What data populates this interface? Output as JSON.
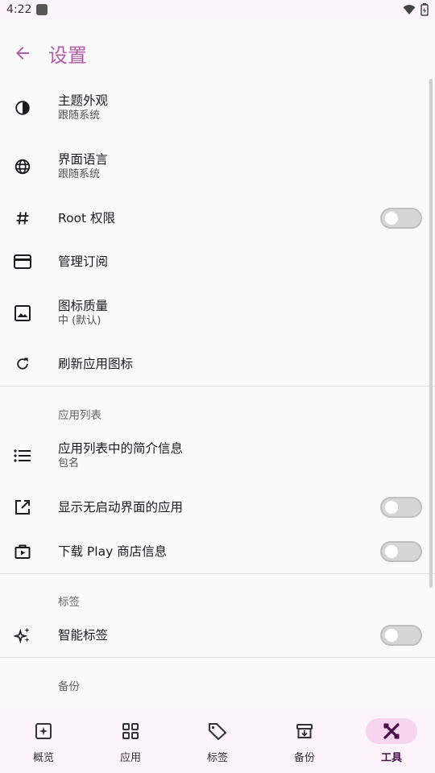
{
  "status_bar": {
    "time": "4:22"
  },
  "header": {
    "title": "设置"
  },
  "settings": [
    {
      "title": "主题外观",
      "subtitle": "跟随系统"
    },
    {
      "title": "界面语言",
      "subtitle": "跟随系统"
    },
    {
      "title": "Root 权限",
      "toggle": false
    },
    {
      "title": "管理订阅"
    },
    {
      "title": "图标质量",
      "subtitle": "中 (默认)"
    },
    {
      "title": "刷新应用图标"
    }
  ],
  "sections": {
    "app_list": {
      "header": "应用列表",
      "items": [
        {
          "title": "应用列表中的简介信息",
          "subtitle": "包名"
        },
        {
          "title": "显示无启动界面的应用",
          "toggle": false
        },
        {
          "title": "下载 Play 商店信息",
          "toggle": false
        }
      ]
    },
    "tags": {
      "header": "标签",
      "items": [
        {
          "title": "智能标签",
          "toggle": false
        }
      ]
    },
    "backup": {
      "header": "备份"
    }
  },
  "bottom_nav": [
    {
      "label": "概览",
      "icon": "overview-icon"
    },
    {
      "label": "应用",
      "icon": "apps-grid-icon"
    },
    {
      "label": "标签",
      "icon": "tag-icon"
    },
    {
      "label": "备份",
      "icon": "archive-icon"
    },
    {
      "label": "工具",
      "icon": "tools-icon",
      "active": true
    }
  ],
  "colors": {
    "accent": "#b15ba6",
    "nav_active_bg": "#f6d6ee",
    "nav_bg": "#fcf3fb"
  }
}
